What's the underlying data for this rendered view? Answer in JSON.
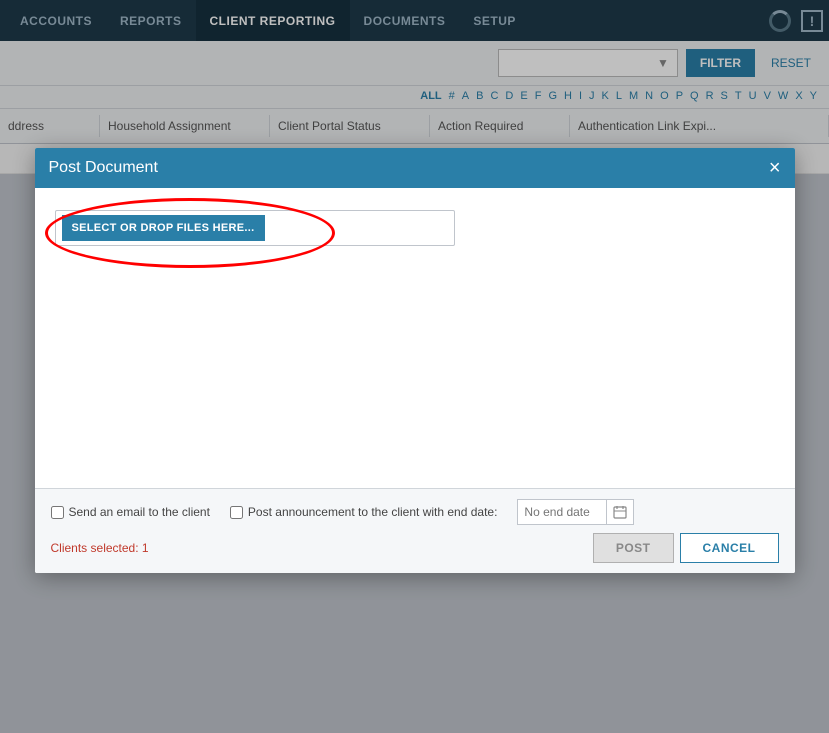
{
  "nav": {
    "items": [
      {
        "label": "ACCOUNTS",
        "active": false
      },
      {
        "label": "REPORTS",
        "active": false
      },
      {
        "label": "CLIENT REPORTING",
        "active": true
      },
      {
        "label": "DOCUMENTS",
        "active": false
      },
      {
        "label": "SETUP",
        "active": false
      }
    ]
  },
  "filter": {
    "button_label": "FILTER",
    "reset_label": "RESET"
  },
  "alpha": {
    "all_label": "ALL",
    "letters": [
      "#",
      "A",
      "B",
      "C",
      "D",
      "E",
      "F",
      "G",
      "H",
      "I",
      "J",
      "K",
      "L",
      "M",
      "N",
      "O",
      "P",
      "Q",
      "R",
      "S",
      "T",
      "U",
      "V",
      "W",
      "X",
      "Y"
    ]
  },
  "table": {
    "headers": [
      "ddress",
      "Household Assignment",
      "Client Portal Status",
      "Action Required",
      "Authentication Link Expi..."
    ]
  },
  "modal": {
    "title": "Post Document",
    "close_label": "×",
    "select_files_label": "SELECT OR DROP FILES HERE...",
    "footer": {
      "send_email_label": "Send an email to the client",
      "post_announcement_label": "Post announcement to the client with end date:",
      "no_end_date_placeholder": "No end date",
      "clients_selected_label": "Clients selected: 1",
      "post_button_label": "POST",
      "cancel_button_label": "CANCEL"
    }
  }
}
